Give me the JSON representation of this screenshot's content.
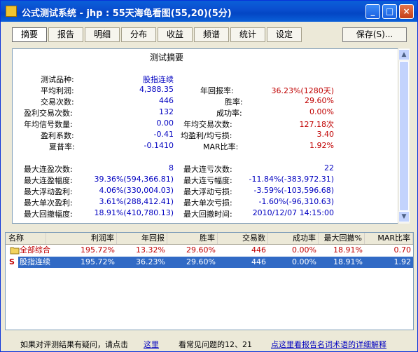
{
  "window": {
    "title": "公式测试系统 - jhp : 55天海龟看图(55,20)(5分)",
    "minimize": "_",
    "maximize": "□",
    "close": "×"
  },
  "tabs": [
    "摘要",
    "报告",
    "明细",
    "分布",
    "收益",
    "频谱",
    "统计",
    "设定"
  ],
  "save_label": "保存(S)...",
  "report": {
    "title": "测试摘要",
    "rows_left": [
      {
        "label": "测试品种:",
        "value": "股指连续"
      },
      {
        "label": "平均利润:",
        "value": "4,388.35"
      },
      {
        "label": "交易次数:",
        "value": "446"
      },
      {
        "label": "盈利交易次数:",
        "value": "132"
      },
      {
        "label": "年均信号数量:",
        "value": "0.00"
      },
      {
        "label": "盈利系数:",
        "value": "-0.41"
      },
      {
        "label": "夏普率:",
        "value": "-0.1410"
      }
    ],
    "rows_right": [
      {
        "label": "年回报率:",
        "value": "36.23%(1280天)"
      },
      {
        "label": "胜率:",
        "value": "29.60%"
      },
      {
        "label": "成功率:",
        "value": "0.00%"
      },
      {
        "label": "年均交易次数:",
        "value": "127.18次"
      },
      {
        "label": "均盈利/均亏损:",
        "value": "3.40"
      },
      {
        "label": "MAR比率:",
        "value": "1.92%"
      }
    ],
    "rows2_left": [
      {
        "label": "最大连盈次数:",
        "value": "8"
      },
      {
        "label": "最大连盈幅度:",
        "value": "39.36%(594,366.81)"
      },
      {
        "label": "最大浮动盈利:",
        "value": "4.06%(330,004.03)"
      },
      {
        "label": "最大单次盈利:",
        "value": "3.61%(288,412.41)"
      },
      {
        "label": "最大回撤幅度:",
        "value": "18.91%(410,780.13)"
      }
    ],
    "rows2_right": [
      {
        "label": "最大连亏次数:",
        "value": "22"
      },
      {
        "label": "最大连亏幅度:",
        "value": "-11.84%(-383,972.31)"
      },
      {
        "label": "最大浮动亏损:",
        "value": "-3.59%(-103,596.68)"
      },
      {
        "label": "最大单次亏损:",
        "value": "-1.60%(-96,310.63)"
      },
      {
        "label": "最大回撤时间:",
        "value": "2010/12/07 14:15:00"
      }
    ]
  },
  "grid": {
    "headers": [
      "名称",
      "利润率",
      "年回报",
      "胜率",
      "交易数",
      "成功率",
      "最大回撤%",
      "MAR比率"
    ],
    "rows": [
      {
        "icon": "folder-icon",
        "cells": [
          "全部综合",
          "195.72%",
          "13.32%",
          "29.60%",
          "446",
          "0.00%",
          "18.91%",
          "0.70"
        ]
      },
      {
        "icon": "S",
        "cells": [
          "股指连续",
          "195.72%",
          "36.23%",
          "29.60%",
          "446",
          "0.00%",
          "18.91%",
          "1.92"
        ]
      }
    ]
  },
  "footer": {
    "question": "如果对评测结果有疑问，请点击",
    "here": "这里",
    "faq": "看常见问题的12、21",
    "detail_link": "点这里看报告名词术语的详细解释"
  }
}
